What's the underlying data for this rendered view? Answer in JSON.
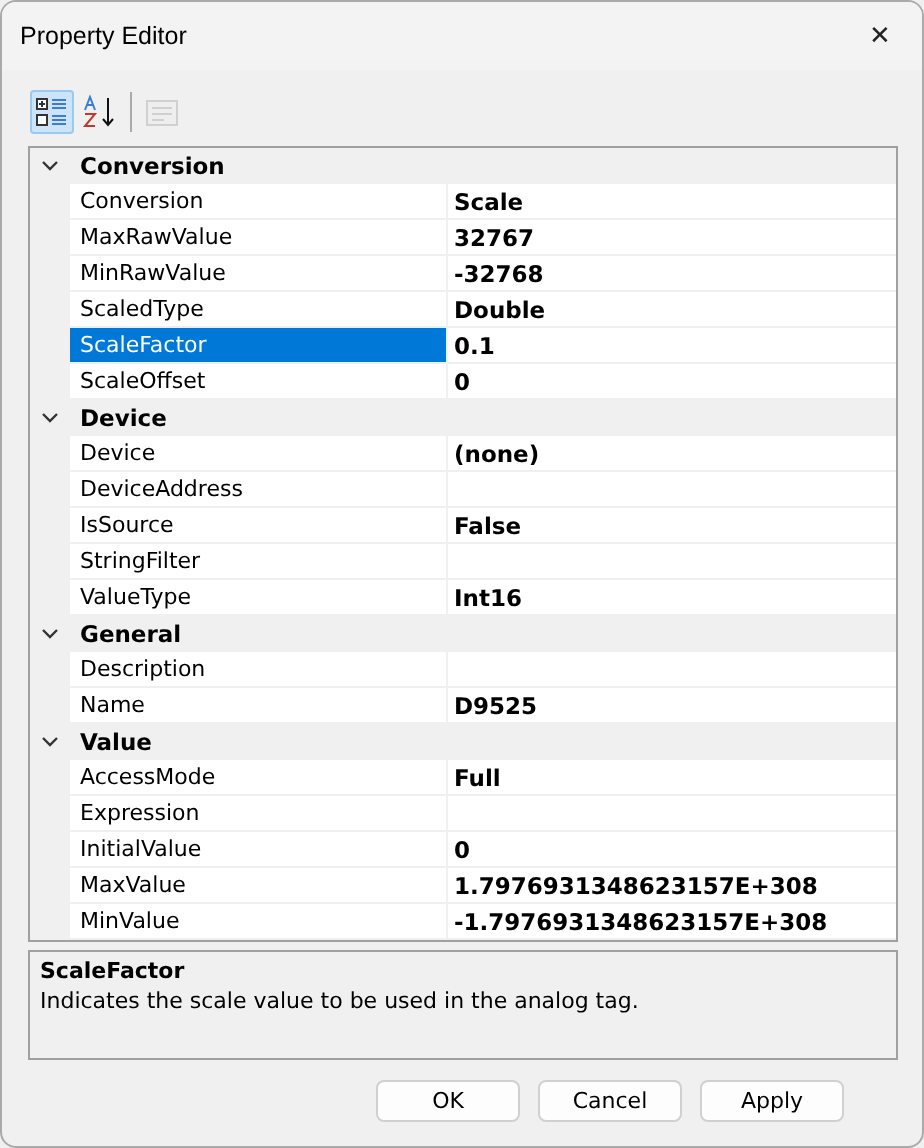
{
  "window": {
    "title": "Property Editor",
    "close": "✕"
  },
  "toolbar": [
    {
      "kind": "categorized",
      "selected": true,
      "disabled": false
    },
    {
      "kind": "alphabetical",
      "selected": false,
      "disabled": false
    },
    {
      "kind": "pages",
      "selected": false,
      "disabled": true
    }
  ],
  "categories": [
    {
      "name": "Conversion",
      "expanded": true,
      "properties": [
        {
          "name": "Conversion",
          "value": "Scale",
          "selected": false
        },
        {
          "name": "MaxRawValue",
          "value": "32767",
          "selected": false
        },
        {
          "name": "MinRawValue",
          "value": "-32768",
          "selected": false
        },
        {
          "name": "ScaledType",
          "value": "Double",
          "selected": false
        },
        {
          "name": "ScaleFactor",
          "value": "0.1",
          "selected": true
        },
        {
          "name": "ScaleOffset",
          "value": "0",
          "selected": false
        }
      ]
    },
    {
      "name": "Device",
      "expanded": true,
      "properties": [
        {
          "name": "Device",
          "value": "(none)",
          "selected": false
        },
        {
          "name": "DeviceAddress",
          "selected": false
        },
        {
          "name": "IsSource",
          "value": "False",
          "selected": false
        },
        {
          "name": "StringFilter",
          "selected": false
        },
        {
          "name": "ValueType",
          "value": "Int16",
          "selected": false
        }
      ]
    },
    {
      "name": "General",
      "expanded": true,
      "properties": [
        {
          "name": "Description",
          "selected": false
        },
        {
          "name": "Name",
          "value": "D9525",
          "selected": false
        }
      ]
    },
    {
      "name": "Value",
      "expanded": true,
      "properties": [
        {
          "name": "AccessMode",
          "value": "Full",
          "selected": false
        },
        {
          "name": "Expression",
          "selected": false
        },
        {
          "name": "InitialValue",
          "value": "0",
          "selected": false
        },
        {
          "name": "MaxValue",
          "value": "1.7976931348623157E+308",
          "selected": false
        },
        {
          "name": "MinValue",
          "value": "-1.7976931348623157E+308",
          "selected": false
        }
      ]
    }
  ],
  "description": {
    "title": "ScaleFactor",
    "text": "Indicates the scale value to be used in the analog tag."
  },
  "buttons": [
    "OK",
    "Cancel",
    "Apply"
  ]
}
